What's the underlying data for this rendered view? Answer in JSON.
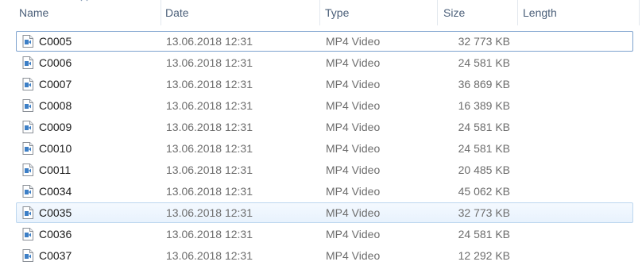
{
  "columns": {
    "name": "Name",
    "date": "Date",
    "type": "Type",
    "size": "Size",
    "length": "Length"
  },
  "files": [
    {
      "name": "C0005",
      "date": "13.06.2018 12:31",
      "type": "MP4 Video",
      "size": "32 773 KB",
      "state": "focused"
    },
    {
      "name": "C0006",
      "date": "13.06.2018 12:31",
      "type": "MP4 Video",
      "size": "24 581 KB",
      "state": ""
    },
    {
      "name": "C0007",
      "date": "13.06.2018 12:31",
      "type": "MP4 Video",
      "size": "36 869 KB",
      "state": ""
    },
    {
      "name": "C0008",
      "date": "13.06.2018 12:31",
      "type": "MP4 Video",
      "size": "16 389 KB",
      "state": ""
    },
    {
      "name": "C0009",
      "date": "13.06.2018 12:31",
      "type": "MP4 Video",
      "size": "24 581 KB",
      "state": ""
    },
    {
      "name": "C0010",
      "date": "13.06.2018 12:31",
      "type": "MP4 Video",
      "size": "24 581 KB",
      "state": ""
    },
    {
      "name": "C0011",
      "date": "13.06.2018 12:31",
      "type": "MP4 Video",
      "size": "20 485 KB",
      "state": ""
    },
    {
      "name": "C0034",
      "date": "13.06.2018 12:31",
      "type": "MP4 Video",
      "size": "45 062 KB",
      "state": ""
    },
    {
      "name": "C0035",
      "date": "13.06.2018 12:31",
      "type": "MP4 Video",
      "size": "32 773 KB",
      "state": "selected"
    },
    {
      "name": "C0036",
      "date": "13.06.2018 12:31",
      "type": "MP4 Video",
      "size": "24 581 KB",
      "state": ""
    },
    {
      "name": "C0037",
      "date": "13.06.2018 12:31",
      "type": "MP4 Video",
      "size": "12 292 KB",
      "state": ""
    }
  ],
  "icons": {
    "file": "video-file-icon",
    "sort": "sort-ascending-icon"
  },
  "colors": {
    "header_text": "#4c607a",
    "focus_border": "#7da2ce",
    "selected_fill": "#e8f2fd",
    "secondary_text": "#6d6d6d"
  }
}
